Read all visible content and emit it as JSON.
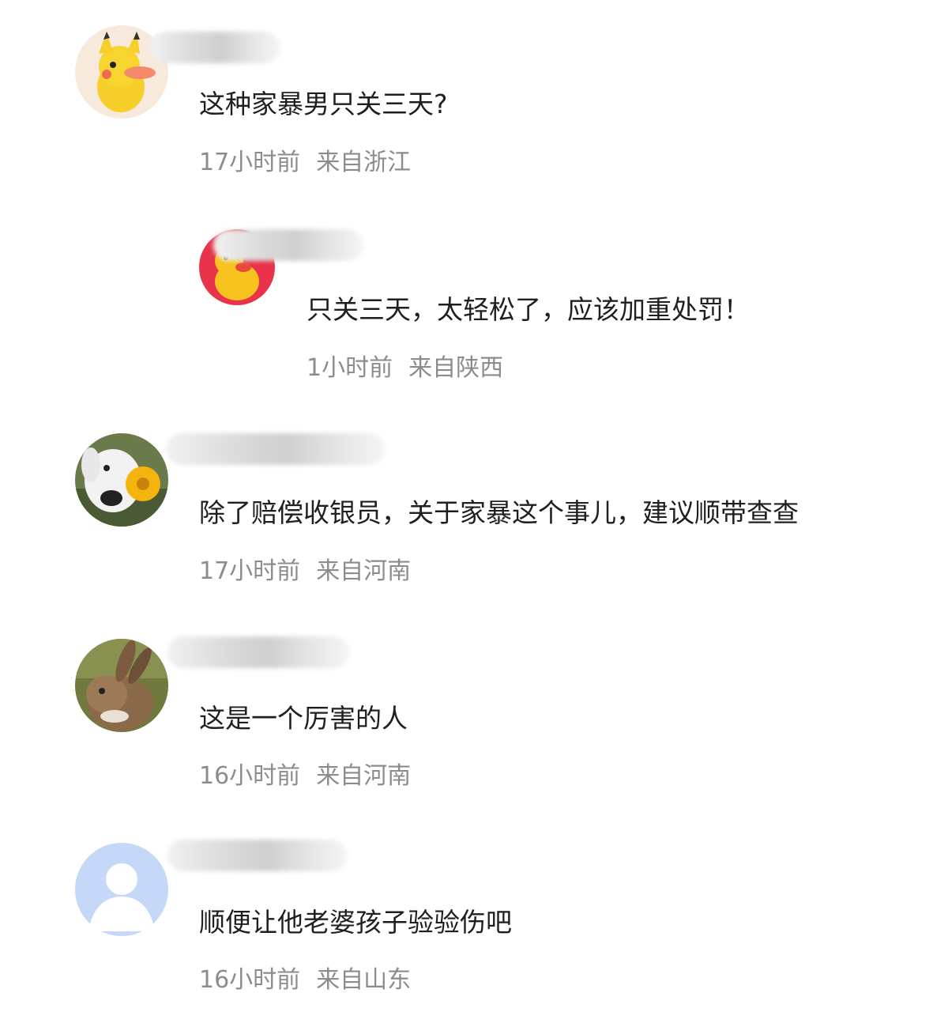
{
  "comments": [
    {
      "text": "这种家暴男只关三天?",
      "time": "17小时前",
      "location": "来自浙江",
      "avatar_icon": "pikachu-duck-avatar"
    },
    {
      "text": "只关三天，太轻松了，应该加重处罚！",
      "time": "1小时前",
      "location": "来自陕西",
      "avatar_icon": "yellow-duck-avatar",
      "reply": true
    },
    {
      "text": "除了赔偿收银员，关于家暴这个事儿，建议顺带查查",
      "time": "17小时前",
      "location": "来自河南",
      "avatar_icon": "dog-flower-avatar"
    },
    {
      "text": "这是一个厉害的人",
      "time": "16小时前",
      "location": "来自河南",
      "avatar_icon": "rabbit-avatar"
    },
    {
      "text": "顺便让他老婆孩子验验伤吧",
      "time": "16小时前",
      "location": "来自山东",
      "avatar_icon": "default-user-avatar"
    }
  ]
}
